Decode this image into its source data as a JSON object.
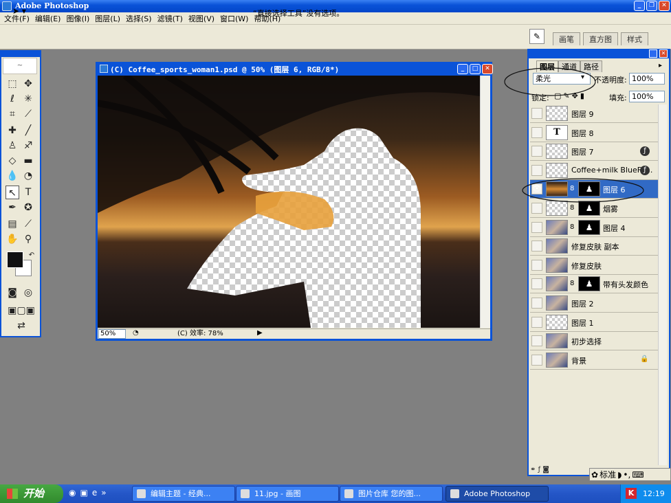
{
  "app": {
    "title": "Adobe Photoshop"
  },
  "menu": [
    "文件(F)",
    "编辑(E)",
    "图像(I)",
    "图层(L)",
    "选择(S)",
    "滤镜(T)",
    "视图(V)",
    "窗口(W)",
    "帮助(H)"
  ],
  "options_bar": {
    "tool_icon": "direct-select-arrow",
    "message": "“直接选择工具”没有选项。",
    "palette_tabs": [
      "画笔",
      "直方图",
      "样式"
    ]
  },
  "document": {
    "title": "(C) Coffee_sports_woman1.psd @ 50% (图层 6, RGB/8*)",
    "zoom": "50%",
    "status": "(C) 效率: 78%"
  },
  "layers_panel": {
    "tabs": [
      "图层",
      "通道",
      "路径"
    ],
    "blend_mode": "柔光",
    "opacity_label": "不透明度:",
    "opacity": "100%",
    "lock_label": "锁定:",
    "fill_label": "填充:",
    "fill": "100%",
    "layers": [
      {
        "name": "图层 9",
        "thumb": "transparent",
        "mask": false,
        "fx": false,
        "visible": false
      },
      {
        "name": "图层 8",
        "thumb": "text",
        "mask": false,
        "fx": false,
        "visible": false
      },
      {
        "name": "图层 7",
        "thumb": "transparent",
        "mask": false,
        "fx": true,
        "visible": false
      },
      {
        "name": "Coffee+milk BlueFa...",
        "thumb": "transparent",
        "mask": false,
        "fx": true,
        "visible": false
      },
      {
        "name": "图层 6",
        "thumb": "sunset",
        "mask": true,
        "fx": false,
        "visible": true,
        "active": true
      },
      {
        "name": "烟雾",
        "thumb": "transparent",
        "mask": true,
        "fx": false,
        "visible": false
      },
      {
        "name": "图层 4",
        "thumb": "photo",
        "mask": true,
        "fx": false,
        "visible": false
      },
      {
        "name": "修复皮肤 副本",
        "thumb": "photo",
        "mask": false,
        "fx": false,
        "visible": false
      },
      {
        "name": "修复皮肤",
        "thumb": "photo",
        "mask": false,
        "fx": false,
        "visible": false
      },
      {
        "name": "带有头发颜色",
        "thumb": "photo",
        "mask": true,
        "fx": false,
        "visible": false
      },
      {
        "name": "图层 2",
        "thumb": "photo",
        "mask": false,
        "fx": false,
        "visible": false
      },
      {
        "name": "图层 1",
        "thumb": "transparent",
        "mask": false,
        "fx": false,
        "visible": false
      },
      {
        "name": "初步选择",
        "thumb": "photo",
        "mask": false,
        "fx": false,
        "visible": false
      },
      {
        "name": "背景",
        "thumb": "photo",
        "mask": false,
        "fx": false,
        "visible": false,
        "locked": true
      }
    ]
  },
  "ime": {
    "label": "标准"
  },
  "taskbar": {
    "start": "开始",
    "tasks": [
      "编辑主题 - 经典...",
      "11.jpg - 画图",
      "图片仓库 您的图...",
      "Adobe Photoshop"
    ],
    "clock": "12:19"
  }
}
